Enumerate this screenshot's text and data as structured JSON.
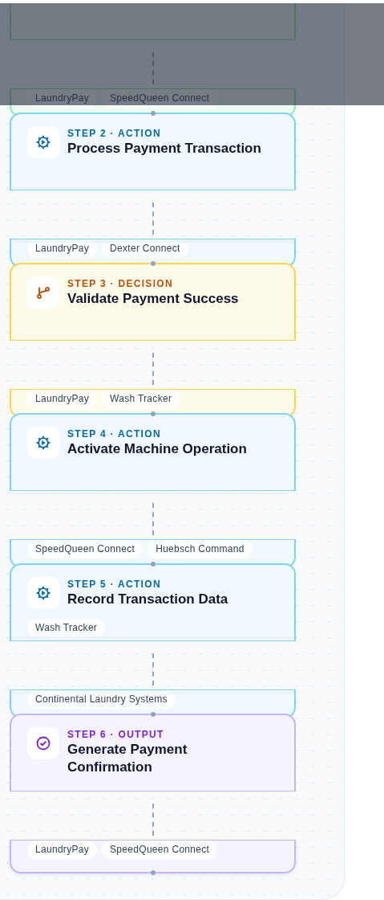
{
  "steps": [
    {
      "kind": "trigger",
      "strip_tags": [
        "LaundryPay",
        "SpeedQueen Connect"
      ]
    },
    {
      "kind": "action",
      "label": "STEP 2 · ACTION",
      "title": "Process Payment Transaction",
      "strip_tags": [
        "LaundryPay",
        "Dexter Connect"
      ]
    },
    {
      "kind": "decision",
      "label": "STEP 3 · DECISION",
      "title": "Validate Payment Success",
      "strip_tags": [
        "LaundryPay",
        "Wash Tracker"
      ]
    },
    {
      "kind": "action",
      "label": "STEP 4 · ACTION",
      "title": "Activate Machine Operation",
      "strip_tags": [
        "SpeedQueen Connect",
        "Huebsch Command"
      ]
    },
    {
      "kind": "action",
      "label": "STEP 5 · ACTION",
      "title": "Record Transaction Data",
      "card_tags": [
        "Wash Tracker"
      ],
      "strip_tags": [
        "Continental Laundry Systems"
      ]
    },
    {
      "kind": "output",
      "label": "STEP 6 · OUTPUT",
      "title": "Generate Payment Confirmation",
      "strip_tags": [
        "LaundryPay",
        "SpeedQueen Connect"
      ]
    }
  ]
}
